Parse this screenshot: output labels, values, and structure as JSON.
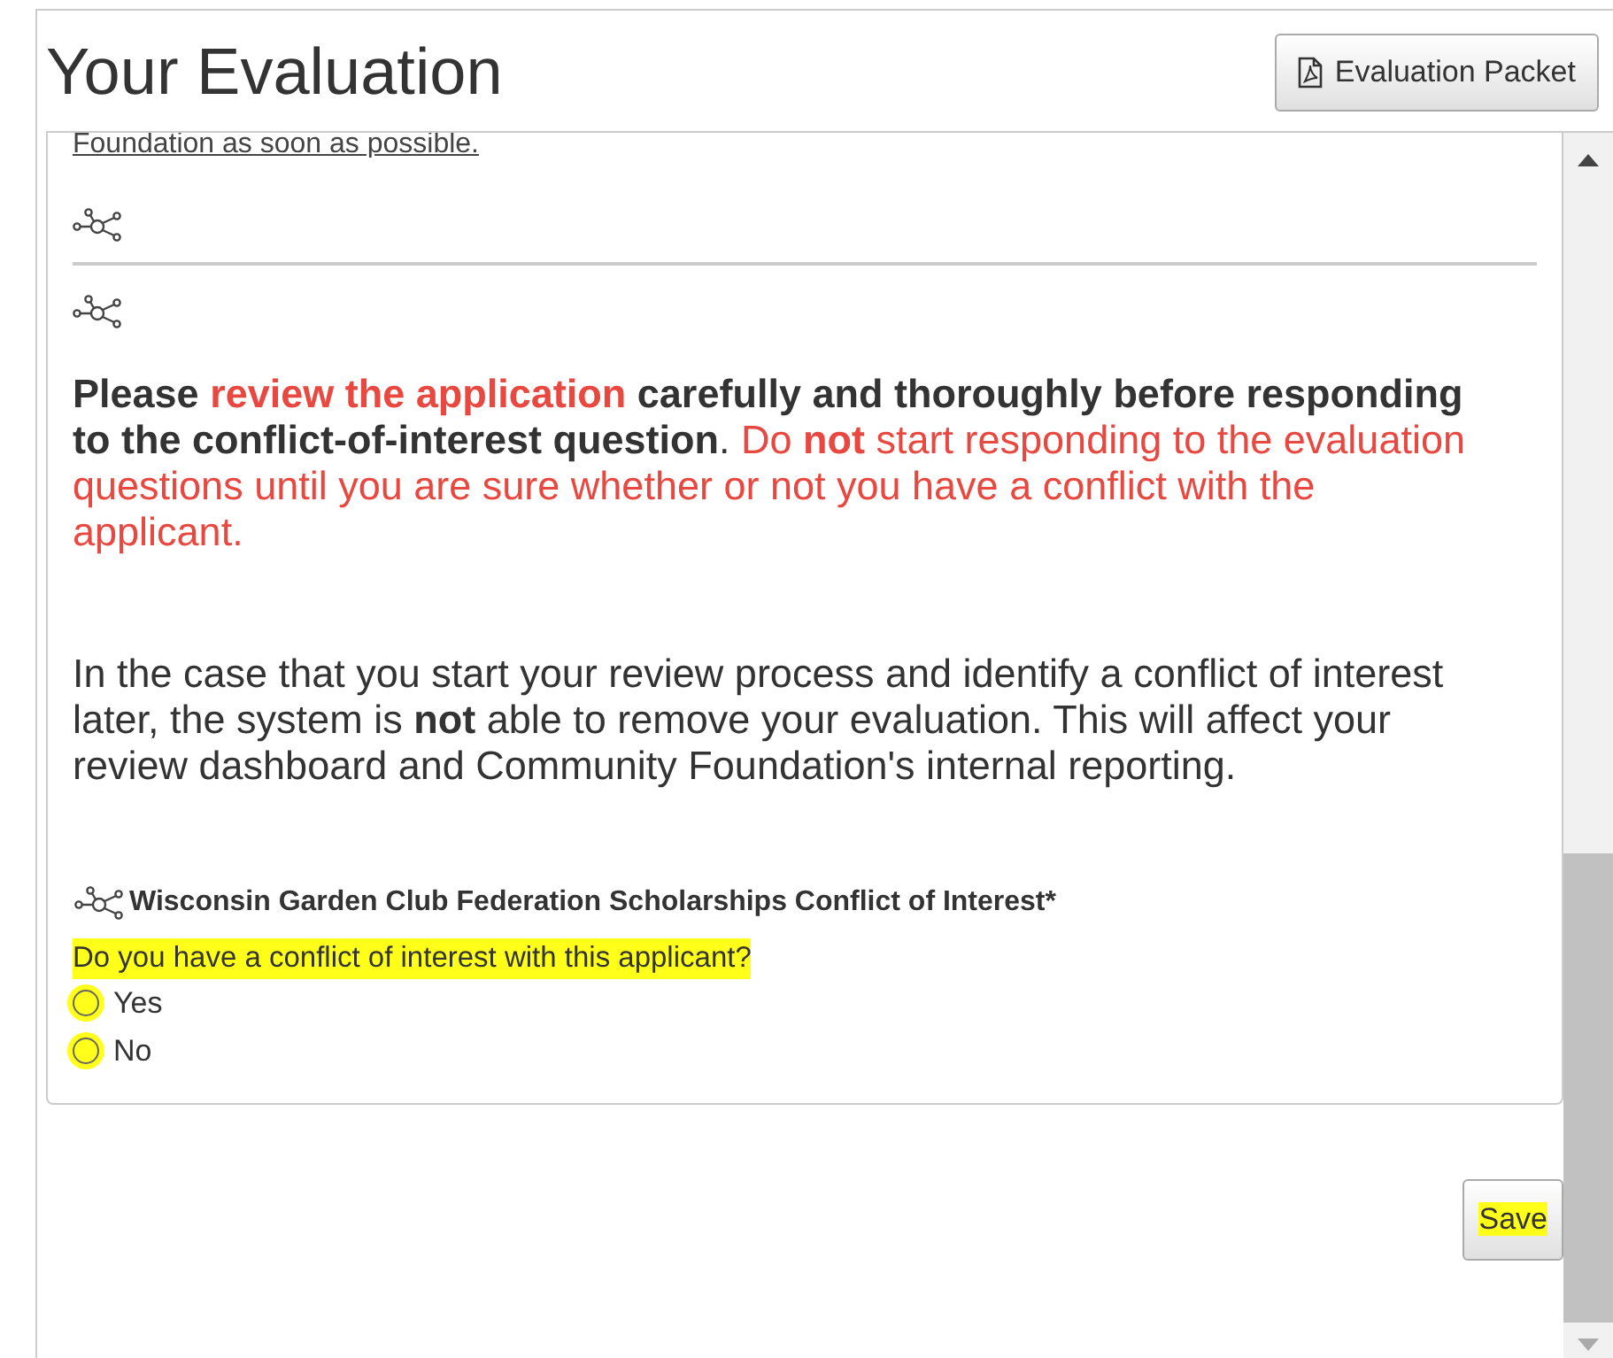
{
  "header": {
    "title": "Your Evaluation",
    "packet_button": "Evaluation Packet"
  },
  "content": {
    "cut_link": "Foundation as soon as possible.",
    "warning": [
      {
        "text": "Please ",
        "bold": true,
        "alert": false
      },
      {
        "text": "review the application",
        "bold": true,
        "alert": true
      },
      {
        "text": " carefully and thoroughly before responding to the conflict-of-interest question",
        "bold": true,
        "alert": false
      },
      {
        "text": ". ",
        "bold": false,
        "alert": false
      },
      {
        "text": "Do ",
        "bold": false,
        "alert": true
      },
      {
        "text": "not",
        "bold": true,
        "alert": true
      },
      {
        "text": " start responding to the evaluation questions until you are sure whether or not you have a conflict with the applicant.",
        "bold": false,
        "alert": true
      }
    ],
    "note": "In the case that you start your review process and identify a conflict of interest later, the system is **not** able to remove your evaluation. This will affect your review dashboard and Community Foundation's internal reporting.",
    "question_title": "Wisconsin Garden Club Federation Scholarships Conflict of Interest*",
    "question": {
      "text": "Do you have a conflict of interest with this applicant?",
      "highlighted": true
    },
    "options": [
      {
        "label": "Yes",
        "selected": false,
        "highlighted": true
      },
      {
        "label": "No",
        "selected": false,
        "highlighted": true
      }
    ]
  },
  "save_button": {
    "label": "Save",
    "highlighted": true
  }
}
